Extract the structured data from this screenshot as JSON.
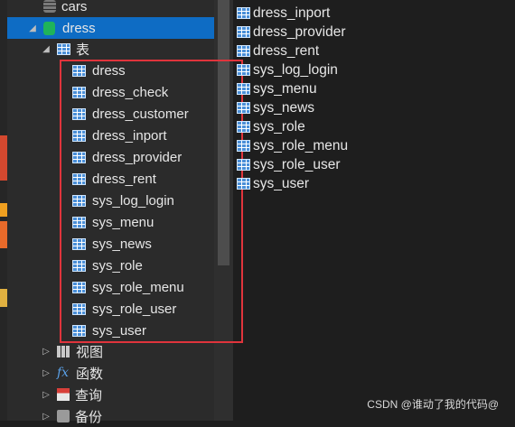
{
  "tree": {
    "connection_cars": "cars",
    "database_dress": "dress",
    "tables_folder": "表",
    "tables": [
      "dress",
      "dress_check",
      "dress_customer",
      "dress_inport",
      "dress_provider",
      "dress_rent",
      "sys_log_login",
      "sys_menu",
      "sys_news",
      "sys_role",
      "sys_role_menu",
      "sys_role_user",
      "sys_user"
    ],
    "views_folder": "视图",
    "functions_folder": "函数",
    "queries_folder": "查询",
    "backups_folder": "备份"
  },
  "right_list": [
    "dress_inport",
    "dress_provider",
    "dress_rent",
    "sys_log_login",
    "sys_menu",
    "sys_news",
    "sys_role",
    "sys_role_menu",
    "sys_role_user",
    "sys_user"
  ],
  "watermark": "CSDN @谁动了我的代码@",
  "colors": {
    "selection": "#0e6cc4",
    "highlight_border": "#e0343c",
    "table_icon": "#4a8fd8",
    "db_icon": "#1fb35a"
  },
  "icons": {
    "connection": "database-stack-icon",
    "database": "database-icon",
    "table": "table-icon",
    "view": "view-icon",
    "function": "fx-icon",
    "query": "query-icon",
    "backup": "backup-icon"
  }
}
